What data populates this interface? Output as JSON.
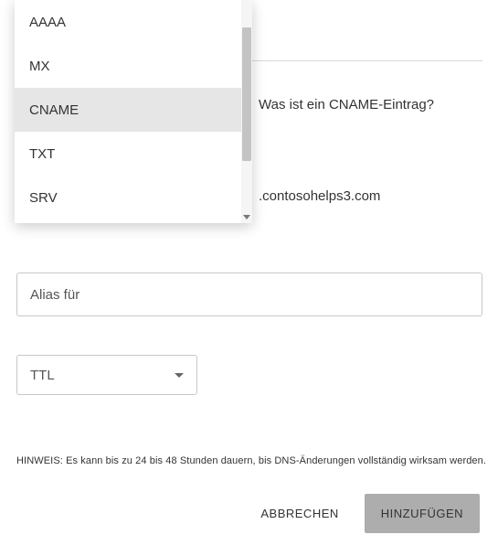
{
  "dropdown": {
    "items": [
      {
        "label": "AAAA",
        "selected": false
      },
      {
        "label": "MX",
        "selected": false
      },
      {
        "label": "CNAME",
        "selected": true
      },
      {
        "label": "TXT",
        "selected": false
      },
      {
        "label": "SRV",
        "selected": false
      }
    ]
  },
  "help": {
    "cname_question": "Was ist ein CNAME-Eintrag?"
  },
  "domain": {
    "suffix": ".contosohelps3.com"
  },
  "alias": {
    "placeholder": "Alias für",
    "value": ""
  },
  "ttl": {
    "label": "TTL"
  },
  "hint": {
    "text": "HINWEIS: Es kann bis zu 24 bis 48 Stunden dauern, bis DNS-Änderungen vollständig wirksam werden."
  },
  "buttons": {
    "cancel": "ABBRECHEN",
    "add": "HINZUFÜGEN"
  }
}
